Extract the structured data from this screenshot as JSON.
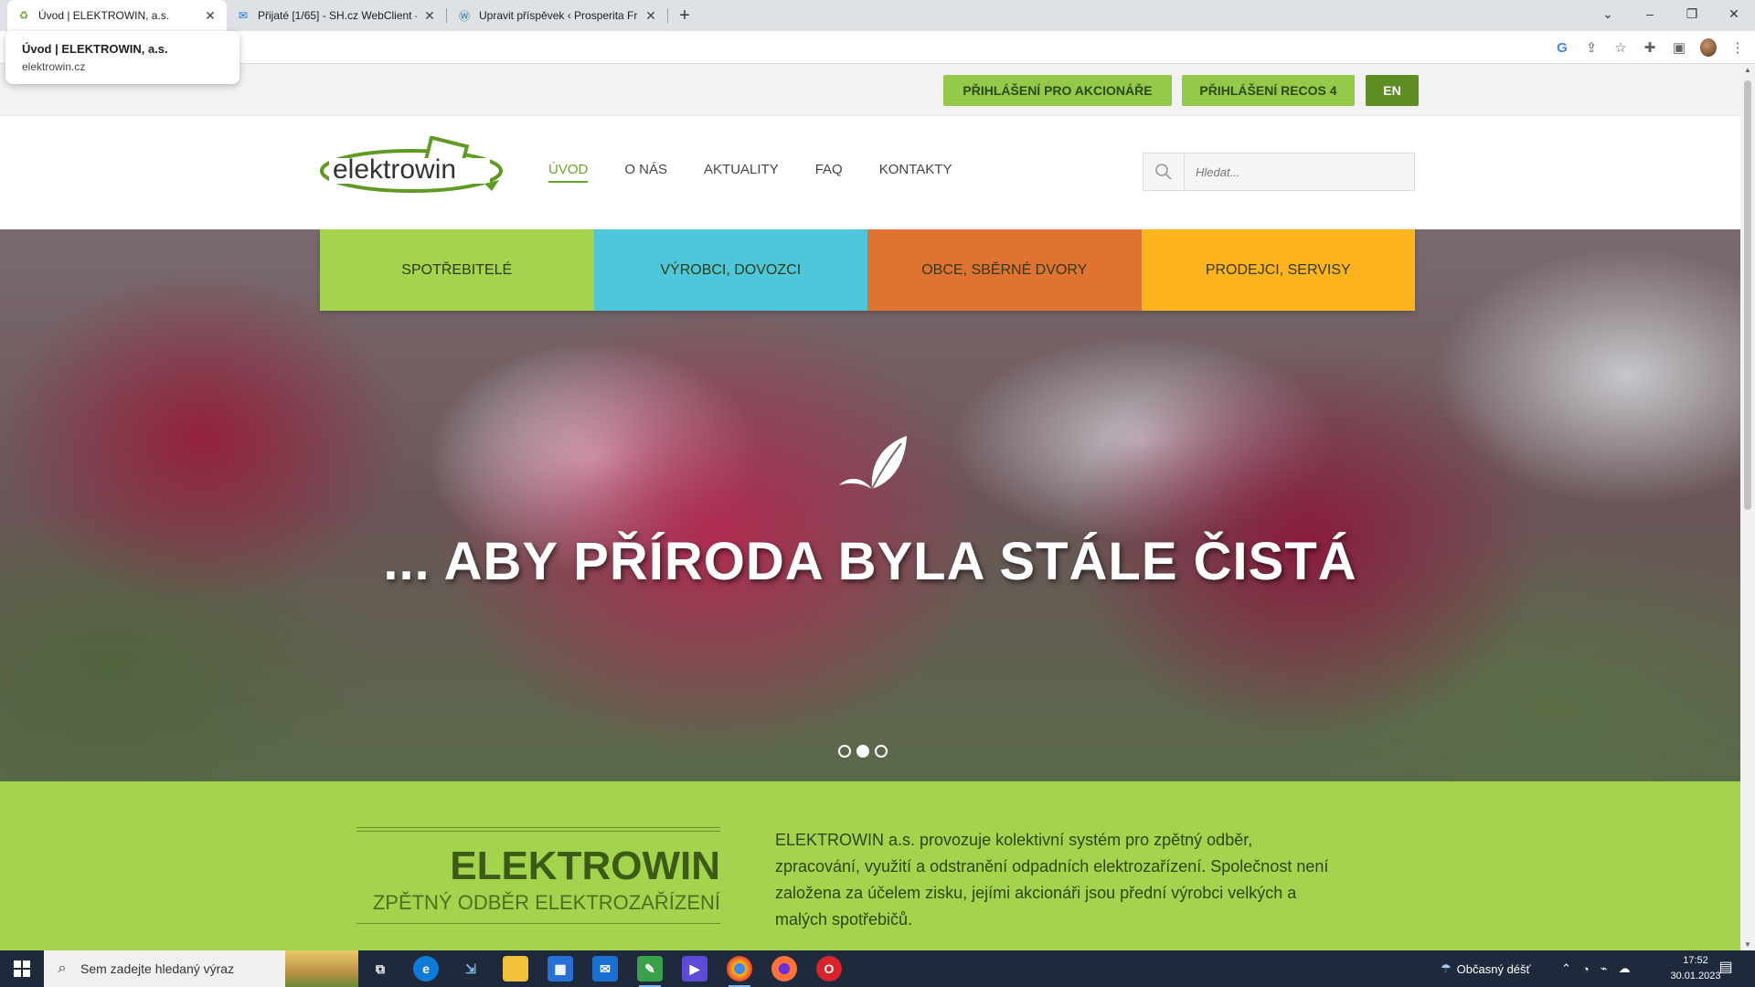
{
  "browser": {
    "tabs": [
      {
        "title": "Úvod | ELEKTROWIN, a.s.",
        "active": true
      },
      {
        "title": "Přijaté [1/65] - SH.cz WebClient -",
        "active": false
      },
      {
        "title": "Upravit příspěvek ‹ Prosperita Fre",
        "active": false
      }
    ],
    "tooltip": {
      "title": "Úvod | ELEKTROWIN, a.s.",
      "url": "elektrowin.cz"
    }
  },
  "topbar": {
    "shareholder_login": "PŘIHLÁŠENÍ PRO AKCIONÁŘE",
    "recos_login": "PŘIHLÁŠENÍ RECOS 4",
    "lang": "EN"
  },
  "header": {
    "logo_text": "elektrowin",
    "nav": [
      {
        "label": "ÚVOD",
        "active": true
      },
      {
        "label": "O NÁS",
        "active": false
      },
      {
        "label": "AKTUALITY",
        "active": false
      },
      {
        "label": "FAQ",
        "active": false
      },
      {
        "label": "KONTAKTY",
        "active": false
      }
    ],
    "search_placeholder": "Hledat..."
  },
  "categories": [
    {
      "label": "SPOTŘEBITELÉ",
      "color": "#a4d44d"
    },
    {
      "label": "VÝROBCI, DOVOZCI",
      "color": "#4ec7da"
    },
    {
      "label": "OBCE, SBĚRNÉ DVORY",
      "color": "#e07232"
    },
    {
      "label": "PRODEJCI, SERVISY",
      "color": "#fdb41e"
    }
  ],
  "hero": {
    "title": "... ABY PŘÍRODA BYLA STÁLE ČISTÁ",
    "slides": 3,
    "active_slide": 2
  },
  "intro": {
    "title": "ELEKTROWIN",
    "subtitle": "ZPĚTNÝ ODBĚR ELEKTROZAŘÍZENÍ",
    "text": "ELEKTROWIN a.s. provozuje kolektivní systém pro zpětný odběr, zpracování, využití a odstranění odpadních elektrozařízení. Společnost není založena za účelem zisku, jejími akcionáři jsou přední výrobci velkých a malých spotřebičů."
  },
  "taskbar": {
    "search_placeholder": "Sem zadejte hledaný výraz",
    "weather": "Občasný déšť",
    "time": "17:52",
    "date": "30.01.2023"
  },
  "colors": {
    "brand_green": "#a4d44d",
    "dark_green": "#5e8d23",
    "accent_nav": "#6aa52c"
  }
}
